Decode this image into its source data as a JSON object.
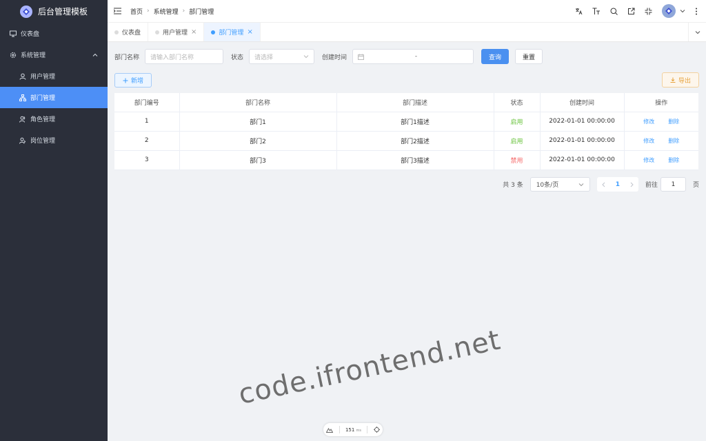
{
  "app": {
    "title": "后台管理模板"
  },
  "sidebar": {
    "items": [
      {
        "label": "仪表盘"
      },
      {
        "label": "系统管理"
      },
      {
        "label": "用户管理"
      },
      {
        "label": "部门管理"
      },
      {
        "label": "角色管理"
      },
      {
        "label": "岗位管理"
      }
    ]
  },
  "breadcrumb": [
    "首页",
    "系统管理",
    "部门管理"
  ],
  "tabs": [
    {
      "label": "仪表盘"
    },
    {
      "label": "用户管理"
    },
    {
      "label": "部门管理"
    }
  ],
  "filters": {
    "name_label": "部门名称",
    "name_placeholder": "请输入部门名称",
    "status_label": "状态",
    "status_placeholder": "请选择",
    "time_label": "创建时间",
    "time_separator": "-",
    "search_label": "查询",
    "reset_label": "重置"
  },
  "toolbar": {
    "add_label": "新增",
    "export_label": "导出"
  },
  "table": {
    "headers": [
      "部门编号",
      "部门名称",
      "部门描述",
      "状态",
      "创建时间",
      "操作"
    ],
    "rows": [
      {
        "id": "1",
        "name": "部门1",
        "desc": "部门1描述",
        "status": "启用",
        "time": "2022-01-01 00:00:00"
      },
      {
        "id": "2",
        "name": "部门2",
        "desc": "部门2描述",
        "status": "启用",
        "time": "2022-01-01 00:00:00"
      },
      {
        "id": "3",
        "name": "部门3",
        "desc": "部门3描述",
        "status": "禁用",
        "time": "2022-01-01 00:00:00"
      }
    ],
    "edit_label": "修改",
    "delete_label": "删除"
  },
  "pagination": {
    "total": "共 3 条",
    "page_size": "10条/页",
    "current_page": "1",
    "goto_label": "前往",
    "goto_value": "1",
    "page_unit": "页"
  },
  "watermark": "code.ifrontend.net",
  "perf": {
    "value": "151",
    "unit": "ms"
  },
  "colors": {
    "primary": "#409eff",
    "sidebar_bg": "#2b2f3a",
    "active_menu": "#4d8ff6",
    "enabled": "#67c23a",
    "disabled": "#f56c6c",
    "export": "#e6a23c"
  }
}
